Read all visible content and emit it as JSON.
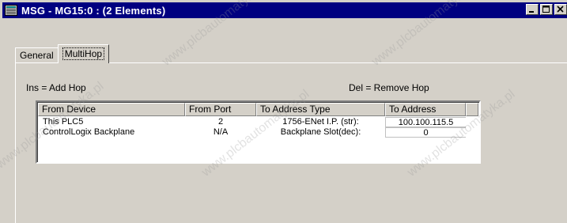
{
  "window": {
    "title": "MSG - MG15:0 : (2 Elements)",
    "icons": {
      "app": "app-window-icon",
      "minimize": "minimize-icon",
      "maximize": "maximize-icon",
      "close": "close-icon"
    },
    "colors": {
      "titlebar": "#000080",
      "face": "#d4d0c8"
    }
  },
  "tabs": [
    {
      "label": "General",
      "active": false
    },
    {
      "label": "MultiHop",
      "active": true
    }
  ],
  "hints": {
    "insert": "Ins = Add Hop",
    "delete": "Del = Remove Hop"
  },
  "table": {
    "columns": [
      "From Device",
      "From Port",
      "To Address Type",
      "To Address"
    ],
    "rows": [
      {
        "from_device": "This PLC5",
        "from_port": "2",
        "to_address_type": "1756-ENet I.P. (str):",
        "to_address": "100.100.115.5"
      },
      {
        "from_device": "ControlLogix Backplane",
        "from_port": "N/A",
        "to_address_type": "Backplane Slot(dec):",
        "to_address": "0"
      }
    ]
  },
  "watermark": "www.plcbautomatyka.pl"
}
